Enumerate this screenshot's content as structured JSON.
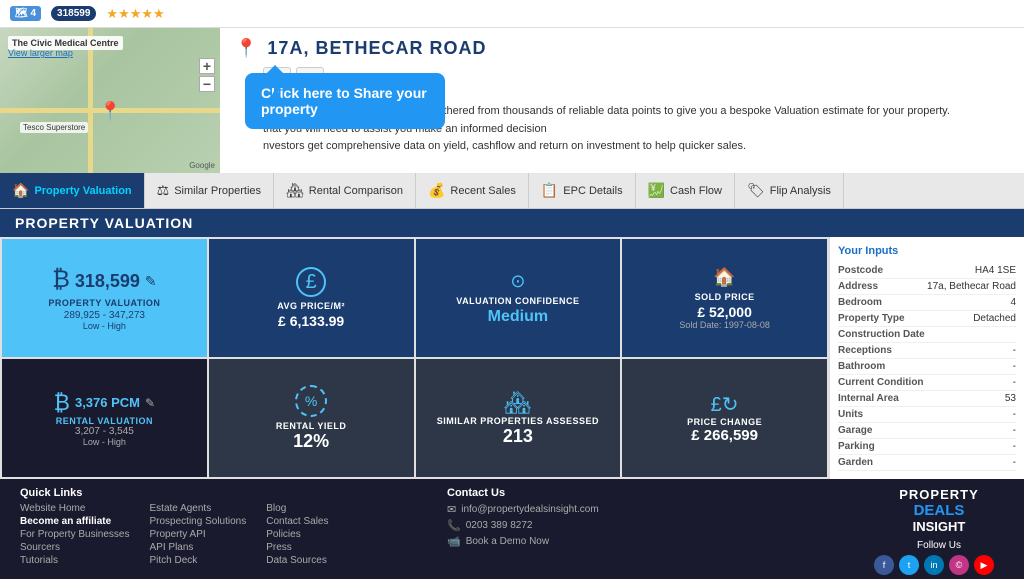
{
  "topbar": {
    "map_icon": "4",
    "score": "318599",
    "stars": "★★★★★"
  },
  "map": {
    "label": "The Civic Medical Centre",
    "sublabel": "View larger map",
    "tesco": "Tesco Superstore",
    "google": "Google"
  },
  "header": {
    "address": "17A, BETHECAR ROAD",
    "tooltip": "Chick here to Share your property",
    "line1": "The data you find below has been gathered from thousands of reliable data points to give you a bespoke Valuation estimate for your property.",
    "line2": "that you will need to assist you make an informed decision",
    "line3": "nvestors get comprehensive data on yield, cashflow and return on investment to help quicker sales."
  },
  "nav": {
    "tabs": [
      {
        "id": "property-valuation",
        "label": "Property Valuation",
        "icon": "🏠",
        "active": true
      },
      {
        "id": "similar-properties",
        "label": "Similar Properties",
        "icon": "⚖",
        "active": false
      },
      {
        "id": "rental-comparison",
        "label": "Rental Comparison",
        "icon": "🏘",
        "active": false
      },
      {
        "id": "recent-sales",
        "label": "Recent Sales",
        "icon": "💰",
        "active": false
      },
      {
        "id": "epc-details",
        "label": "EPC Details",
        "icon": "📋",
        "active": false
      },
      {
        "id": "cash-flow",
        "label": "Cash Flow",
        "icon": "💹",
        "active": false
      },
      {
        "id": "flip-analysis",
        "label": "Flip Analysis",
        "icon": "🏷",
        "active": false
      }
    ]
  },
  "section_title": "PROPERTY VALUATION",
  "metrics": [
    {
      "id": "property-valuation",
      "icon": "₿",
      "label": "PROPERTY VALUATION",
      "value": "318,599",
      "prefix": "₿",
      "range": "289,925 - 347,273",
      "range_label": "Low - High",
      "style": "blue-light",
      "editable": true
    },
    {
      "id": "avg-price",
      "icon": "£",
      "label": "AVG PRICE/M²",
      "value": "£  6,133.99",
      "style": "dark-blue"
    },
    {
      "id": "valuation-confidence",
      "icon": "⊙",
      "label": "VALUATION CONFIDENCE",
      "value": "Medium",
      "style": "dark-blue"
    },
    {
      "id": "sold-price",
      "icon": "🏠",
      "label": "SOLD PRICE",
      "value": "£  52,000",
      "subvalue": "Sold Date: 1997-08-08",
      "style": "dark-blue"
    },
    {
      "id": "rental-valuation",
      "icon": "₿",
      "label": "RENTAL VALUATION",
      "value": "£ 3,376 PCM",
      "range": "3,207 - 3,545",
      "range_label": "Low - High",
      "style": "black",
      "editable": true
    },
    {
      "id": "rental-yield",
      "icon": "%",
      "label": "RENTAL YIELD",
      "value": "12%",
      "style": "dark-gray"
    },
    {
      "id": "similar-assessed",
      "icon": "🏘",
      "label": "SIMILAR PROPERTIES ASSESSED",
      "value": "213",
      "style": "dark-gray"
    },
    {
      "id": "price-change",
      "icon": "£↻",
      "label": "PRICE CHANGE",
      "value": "£  266,599",
      "style": "dark-gray"
    }
  ],
  "inputs": {
    "title": "Your Inputs",
    "fields": [
      {
        "key": "Postcode",
        "val": "HA4 1SE"
      },
      {
        "key": "Address",
        "val": "17a, Bethecar Road"
      },
      {
        "key": "Bedroom",
        "val": "4"
      },
      {
        "key": "Property Type",
        "val": "Detached"
      },
      {
        "key": "Construction Date",
        "val": ""
      },
      {
        "key": "Receptions",
        "val": "-"
      },
      {
        "key": "Bathroom",
        "val": "-"
      },
      {
        "key": "Current Condition",
        "val": "-"
      },
      {
        "key": "Internal Area",
        "val": "53"
      },
      {
        "key": "Units",
        "val": "-"
      },
      {
        "key": "Garage",
        "val": "-"
      },
      {
        "key": "Parking",
        "val": "-"
      },
      {
        "key": "Garden",
        "val": "-"
      }
    ]
  },
  "footer": {
    "quick_links": {
      "title": "Quick Links",
      "col1": [
        {
          "label": "Website Home",
          "bold": false
        },
        {
          "label": "Become an affiliate",
          "bold": true
        },
        {
          "label": "For Property Businesses",
          "bold": false
        },
        {
          "label": "Sourcers",
          "bold": false
        },
        {
          "label": "Tutorials",
          "bold": false
        }
      ],
      "col2": [
        {
          "label": "Estate Agents",
          "bold": false
        },
        {
          "label": "Prospecting Solutions",
          "bold": false
        },
        {
          "label": "Property API",
          "bold": false
        },
        {
          "label": "API Plans",
          "bold": false
        },
        {
          "label": "Pitch Deck",
          "bold": false
        }
      ],
      "col3": [
        {
          "label": "Blog",
          "bold": false
        },
        {
          "label": "Contact Sales",
          "bold": false
        },
        {
          "label": "Policies",
          "bold": false
        },
        {
          "label": "Press",
          "bold": false
        },
        {
          "label": "Data Sources",
          "bold": false
        }
      ]
    },
    "contact": {
      "title": "Contact Us",
      "email": "info@propertydealsinsight.com",
      "phone": "0203 389 8272",
      "demo": "Book a Demo Now"
    },
    "brand": {
      "name1": "PROPERTY",
      "name2": "DEALS",
      "name3": "INSIGHT",
      "follow_title": "Follow Us",
      "socials": [
        "f",
        "t",
        "in",
        "©",
        "▶"
      ]
    }
  }
}
